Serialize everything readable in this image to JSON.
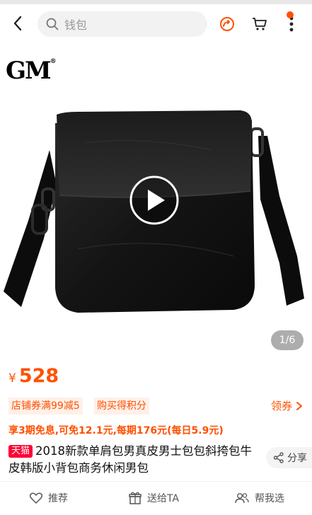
{
  "search": {
    "placeholder": "钱包"
  },
  "media": {
    "logo": "GM",
    "logo_mark": "®",
    "page_indicator": "1/6"
  },
  "price": {
    "currency": "¥",
    "value": "528"
  },
  "promotions": {
    "tags": [
      "店铺券满99减5",
      "购买得积分"
    ],
    "voucher_label": "领券"
  },
  "installment": "享3期免息,可免12.1元,每期176元(每日5.9元)",
  "product": {
    "store_badge": "天猫",
    "title": "2018新款单肩包男真皮男士包包斜挎包牛皮韩版小背包商务休闲男包"
  },
  "share": {
    "label": "分享"
  },
  "bottom_bar": {
    "recommend": "推荐",
    "gift": "送给TA",
    "help_pick": "帮我选"
  },
  "colors": {
    "accent": "#ff5000",
    "tmall": "#ff0036"
  }
}
